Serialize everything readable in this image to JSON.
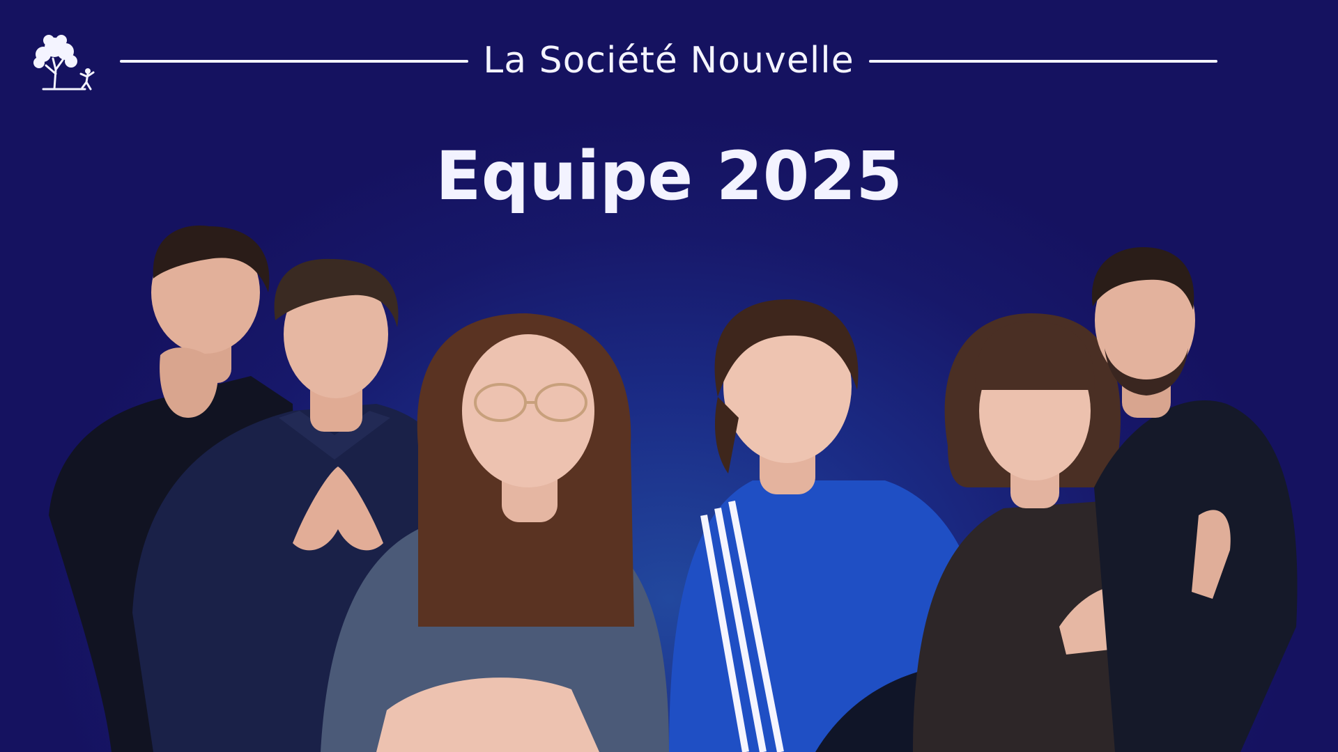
{
  "header": {
    "brand_name": "La Société Nouvelle",
    "logo_icon": "tree-logo-icon"
  },
  "main": {
    "title": "Equipe 2025"
  },
  "photo": {
    "people_count": 7,
    "subjects": [
      "person-1",
      "person-2",
      "person-3",
      "person-4",
      "person-5",
      "person-6",
      "person-7"
    ]
  },
  "colors": {
    "background_dark": "#151260",
    "background_glow": "#22489e",
    "text": "#f3f3ff"
  }
}
